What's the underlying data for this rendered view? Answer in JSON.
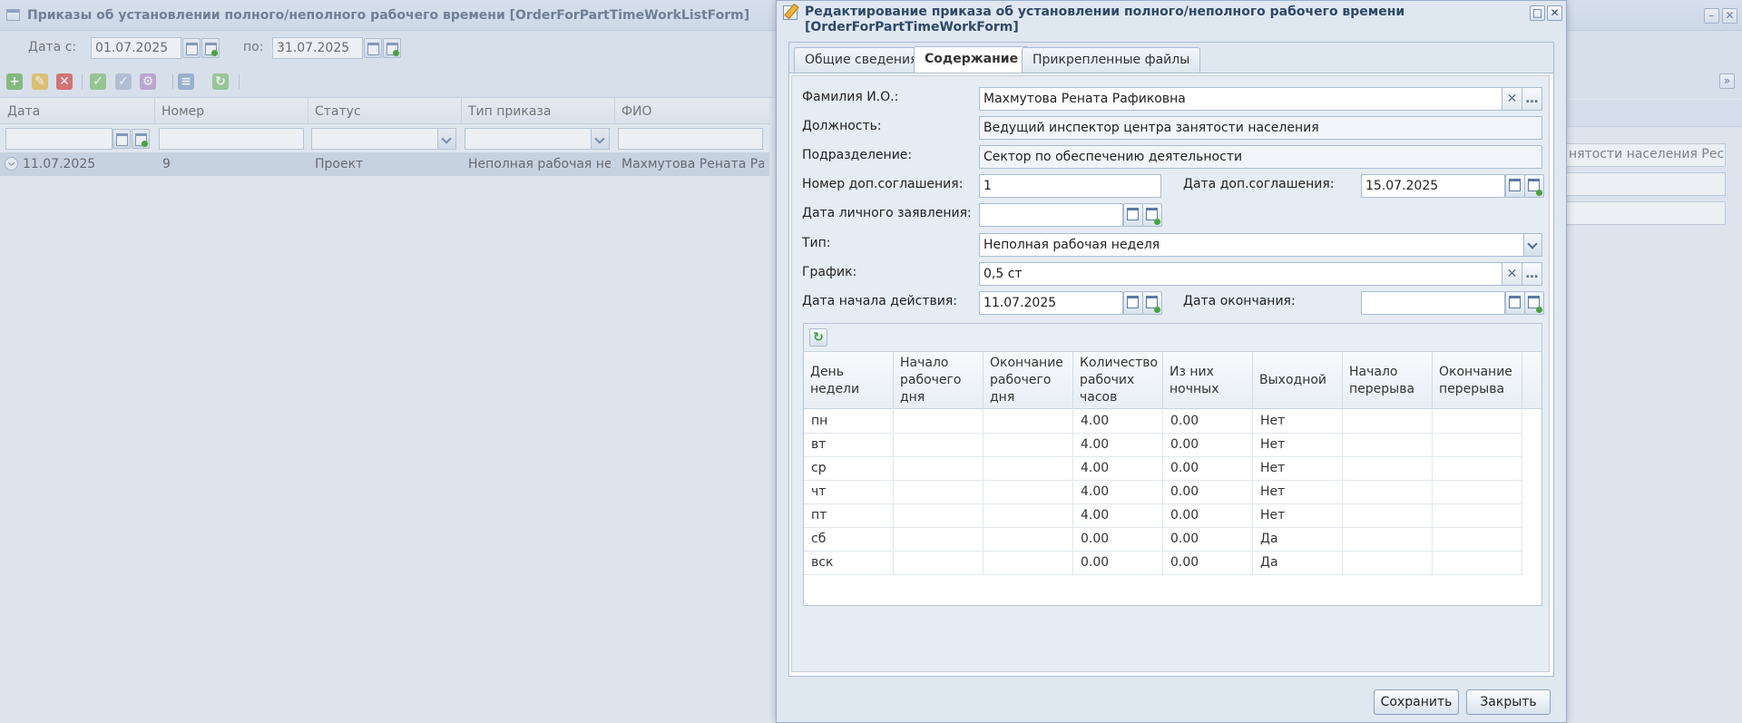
{
  "background": {
    "title": "Приказы об установлении полного/неполного рабочего времени [OrderForPartTimeWorkListForm]",
    "date_from_label": "Дата с:",
    "date_from": "01.07.2025",
    "date_to_label": "по:",
    "date_to": "31.07.2025",
    "columns": [
      "Дата",
      "Номер",
      "Статус",
      "Тип приказа",
      "ФИО"
    ],
    "row": [
      "11.07.2025",
      "9",
      "Проект",
      "Неполная рабочая нед...",
      "Махмутова Рената Ра..."
    ],
    "right_fragment": "нятости населения Респу"
  },
  "dialog": {
    "title_line1": "Редактирование приказа об установлении полного/неполного рабочего времени",
    "title_line2": "[OrderForPartTimeWorkForm]",
    "tabs": [
      "Общие сведения",
      "Содержание",
      "Прикрепленные файлы"
    ],
    "active_tab": "Содержание",
    "fields": {
      "fio_label": "Фамилия И.О.:",
      "fio": "Махмутова Рената Рафиковна",
      "position_label": "Должность:",
      "position": "Ведущий инспектор центра занятости населения",
      "dept_label": "Подразделение:",
      "dept": "Сектор по обеспечению деятельности",
      "agr_num_label": "Номер доп.соглашения:",
      "agr_num": "1",
      "agr_date_label": "Дата доп.соглашения:",
      "agr_date": "15.07.2025",
      "app_date_label": "Дата личного заявления:",
      "app_date": "",
      "type_label": "Тип:",
      "type": "Неполная рабочая неделя",
      "schedule_label": "График:",
      "schedule": "0,5 ст",
      "start_label": "Дата начала действия:",
      "start": "11.07.2025",
      "end_label": "Дата окончания:",
      "end": ""
    },
    "table": {
      "headers": [
        "День недели",
        "Начало рабочего дня",
        "Окончание рабочего дня",
        "Количество рабочих часов",
        "Из них ночных",
        "Выходной",
        "Начало перерыва",
        "Окончание перерыва"
      ],
      "rows": [
        [
          "пн",
          "",
          "",
          "4.00",
          "0.00",
          "Нет",
          "",
          ""
        ],
        [
          "вт",
          "",
          "",
          "4.00",
          "0.00",
          "Нет",
          "",
          ""
        ],
        [
          "ср",
          "",
          "",
          "4.00",
          "0.00",
          "Нет",
          "",
          ""
        ],
        [
          "чт",
          "",
          "",
          "4.00",
          "0.00",
          "Нет",
          "",
          ""
        ],
        [
          "пт",
          "",
          "",
          "4.00",
          "0.00",
          "Нет",
          "",
          ""
        ],
        [
          "сб",
          "",
          "",
          "0.00",
          "0.00",
          "Да",
          "",
          ""
        ],
        [
          "вск",
          "",
          "",
          "0.00",
          "0.00",
          "Да",
          "",
          ""
        ]
      ]
    },
    "buttons": {
      "save": "Сохранить",
      "close": "Закрыть"
    }
  }
}
